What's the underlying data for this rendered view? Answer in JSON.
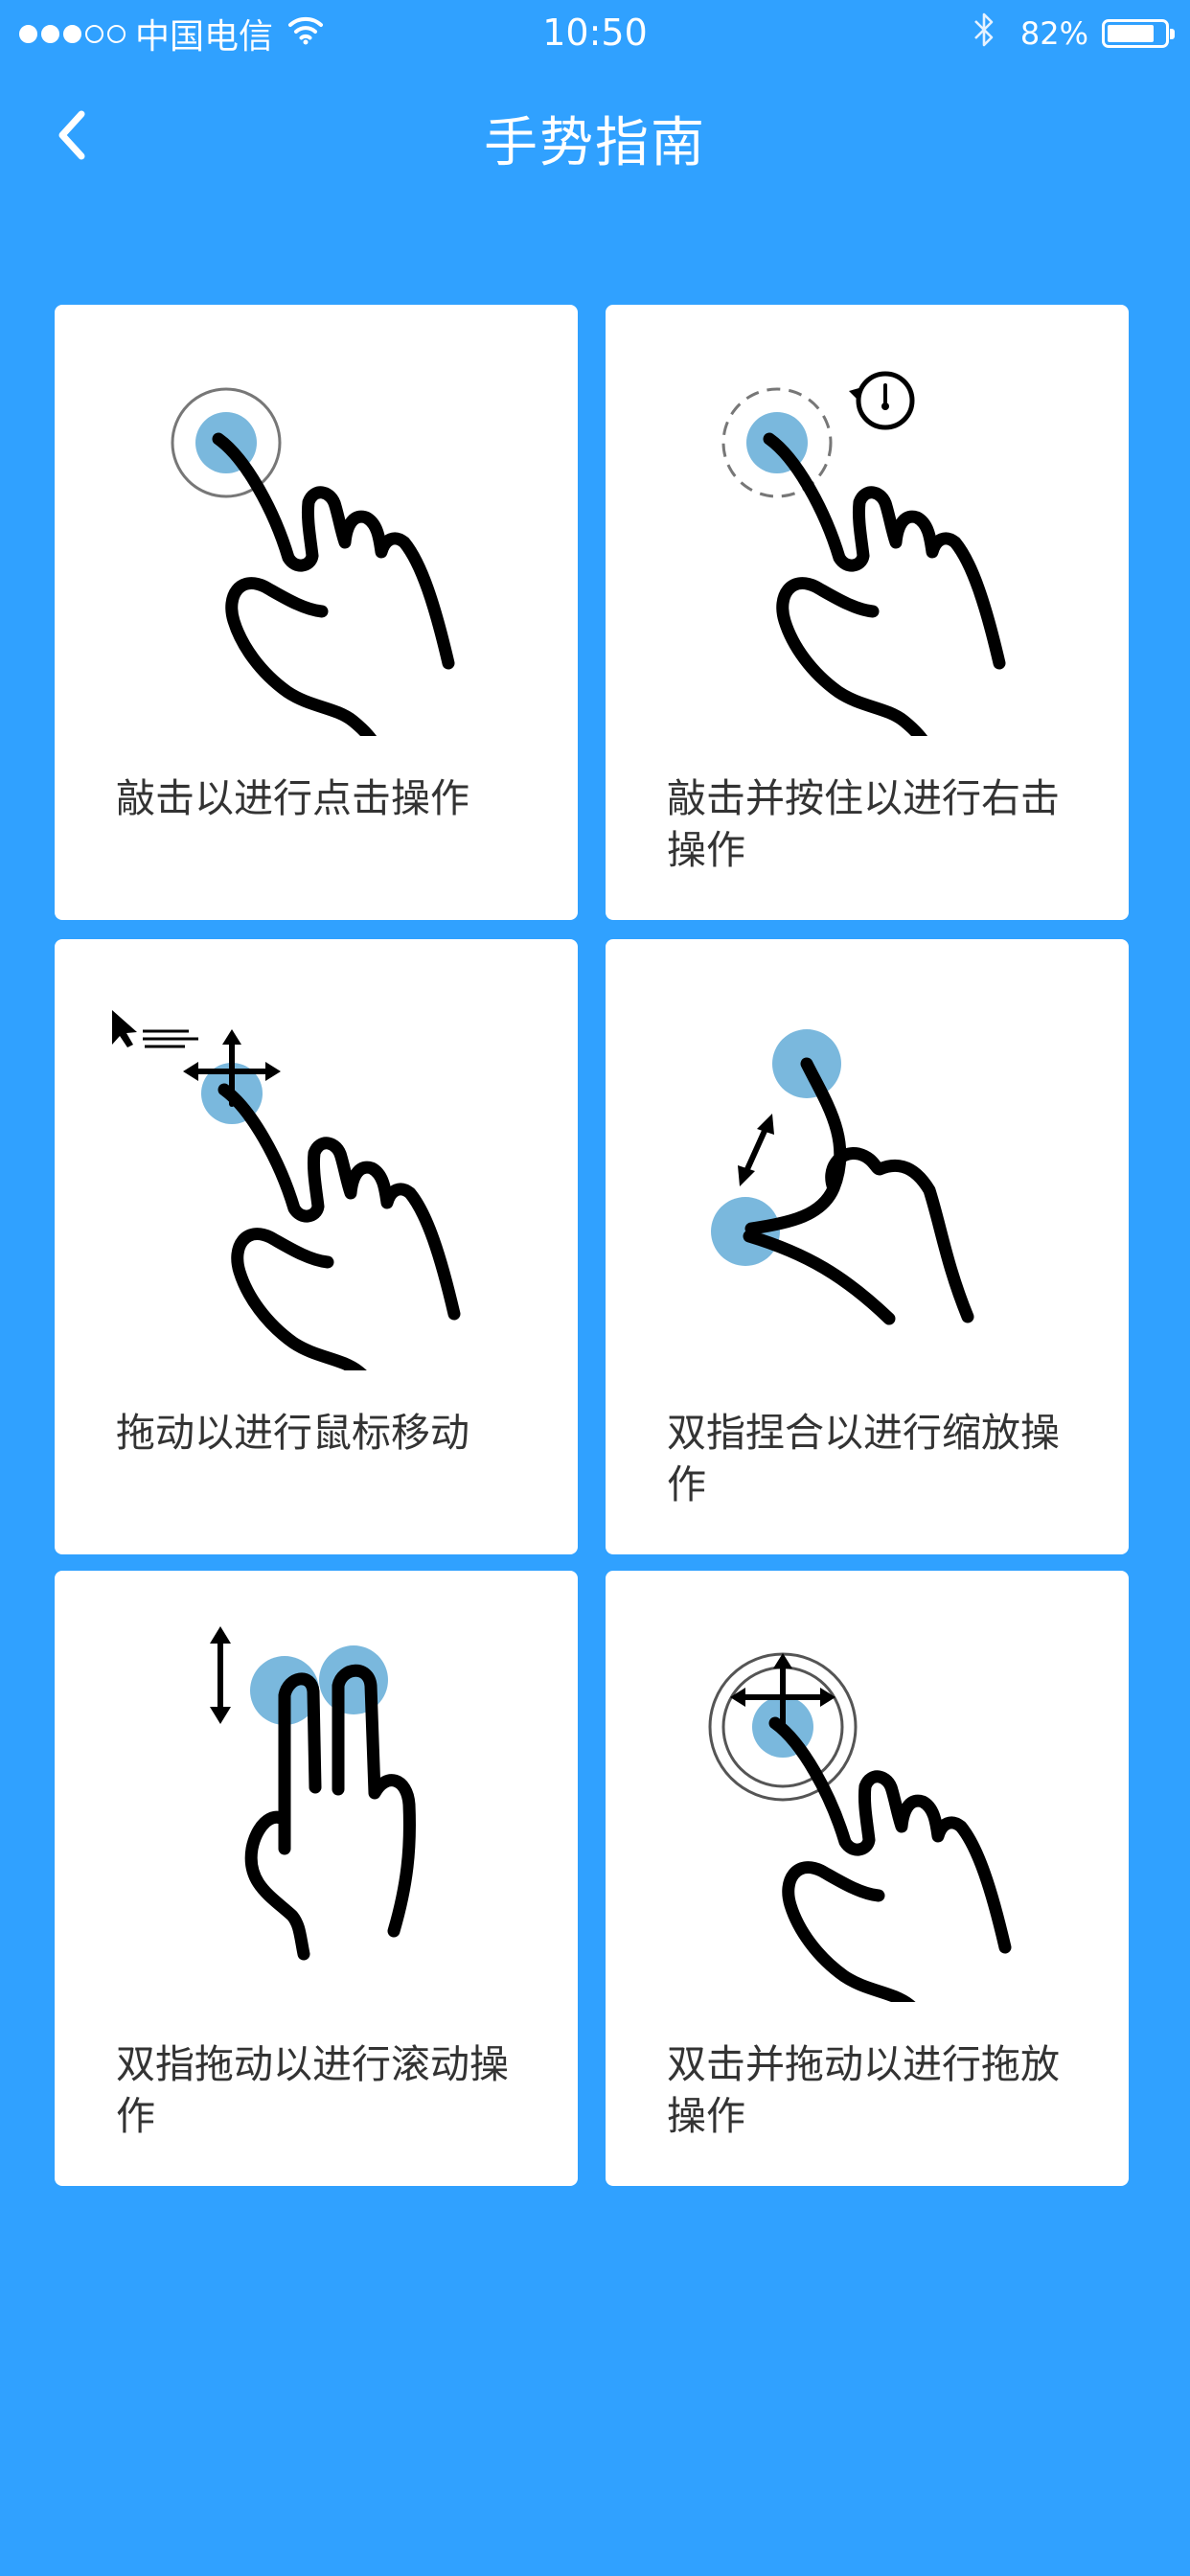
{
  "status_bar": {
    "carrier": "中国电信",
    "time": "10:50",
    "battery": "82%"
  },
  "nav": {
    "title": "手势指南"
  },
  "colors": {
    "background": "#30a1ff",
    "card": "#ffffff",
    "touch_point": "#7ab8dd",
    "text": "#333333"
  },
  "gestures": [
    {
      "label": "敲击以进行点击操作",
      "icon": "tap-gesture"
    },
    {
      "label": "敲击并按住以进行右击操作",
      "icon": "tap-and-hold-gesture"
    },
    {
      "label": "拖动以进行鼠标移动",
      "icon": "drag-move-gesture"
    },
    {
      "label": "双指捏合以进行缩放操作",
      "icon": "pinch-zoom-gesture"
    },
    {
      "label": "双指拖动以进行滚动操作",
      "icon": "two-finger-scroll-gesture"
    },
    {
      "label": "双击并拖动以进行拖放操作",
      "icon": "double-tap-drag-gesture"
    }
  ]
}
